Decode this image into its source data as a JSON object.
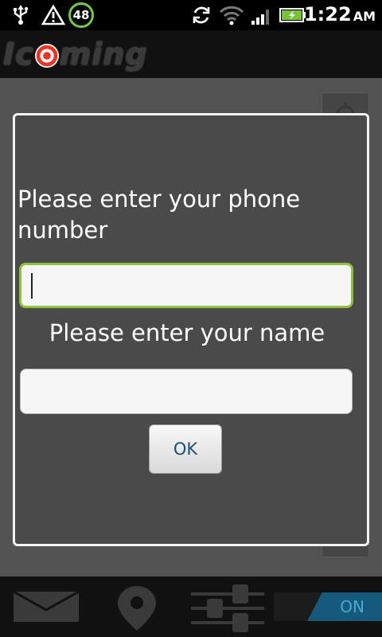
{
  "status_bar": {
    "badge_count": "48",
    "time": "1:22",
    "ampm": "AM",
    "icons": [
      "usb-icon",
      "warning-icon",
      "sync-icon",
      "wifi-icon",
      "signal-icon",
      "battery-charging-icon"
    ]
  },
  "app": {
    "logo_text_pre": "Ic",
    "logo_text_post": "ming"
  },
  "dialog": {
    "phone_label": "Please enter your phone number",
    "phone_value": "",
    "name_label": "Please enter your name",
    "name_value": "",
    "ok_label": "OK"
  },
  "bottom_bar": {
    "toggle_label": "ON",
    "icons": [
      "mail-icon",
      "location-pin-icon",
      "settings-sliders-icon"
    ]
  },
  "colors": {
    "accent_green": "#8fc03a",
    "toggle_blue": "#47a9d8"
  }
}
